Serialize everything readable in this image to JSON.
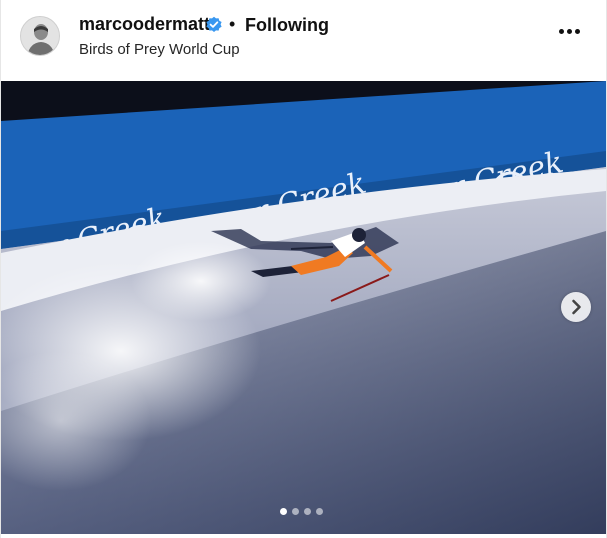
{
  "post": {
    "username": "marcoodermatt",
    "separator": "•",
    "follow_status": "Following",
    "location": "Birds of Prey World Cup",
    "banner_text": "Beaver Creek",
    "carousel": {
      "current": 1,
      "total": 4
    }
  },
  "icons": {
    "verified": "verified-badge-icon",
    "more": "more-options-icon",
    "next": "chevron-right-icon"
  },
  "colors": {
    "verified_blue": "#3897f0",
    "banner_blue": "#1b63b8",
    "text": "#111111"
  }
}
